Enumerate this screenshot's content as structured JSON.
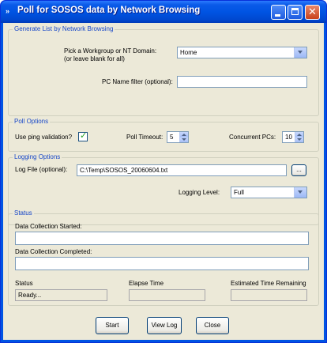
{
  "window": {
    "title": "Poll for SOSOS data by Network Browsing",
    "icon": "double-chevron-icon",
    "controls": [
      "minimize-icon",
      "maximize-icon",
      "close-icon"
    ]
  },
  "generate": {
    "legend": "Generate List by Network Browsing",
    "domain_label_line1": "Pick a Workgroup or NT Domain:",
    "domain_label_line2": "(or leave blank for all)",
    "domain_value": "Home",
    "pc_filter_label": "PC Name filter (optional):",
    "pc_filter_value": ""
  },
  "poll": {
    "legend": "Poll Options",
    "ping_label": "Use ping validation?",
    "ping_checked": true,
    "timeout_label": "Poll Timeout:",
    "timeout_value": "5",
    "concurrent_label": "Concurrent PCs:",
    "concurrent_value": "10"
  },
  "logging": {
    "legend": "Logging Options",
    "logfile_label": "Log File (optional):",
    "logfile_value": "C:\\Temp\\SOSOS_20060604.txt",
    "browse_label": "...",
    "level_label": "Logging Level:",
    "level_value": "Full"
  },
  "status": {
    "legend": "Status",
    "started_label": "Data Collection Started:",
    "started_value": "",
    "completed_label": "Data Collection Completed:",
    "completed_value": "",
    "status_label": "Status",
    "status_value": "Ready...",
    "elapsed_label": "Elapse Time",
    "elapsed_value": "",
    "remaining_label": "Estimated Time Remaining",
    "remaining_value": ""
  },
  "buttons": {
    "start": "Start",
    "view_log": "View Log",
    "close": "Close"
  },
  "colors": {
    "titlebar": "#0054e3",
    "face": "#ece9d8",
    "legend_text": "#1747c8",
    "field_border": "#7f9db9",
    "check": "#21a121"
  }
}
